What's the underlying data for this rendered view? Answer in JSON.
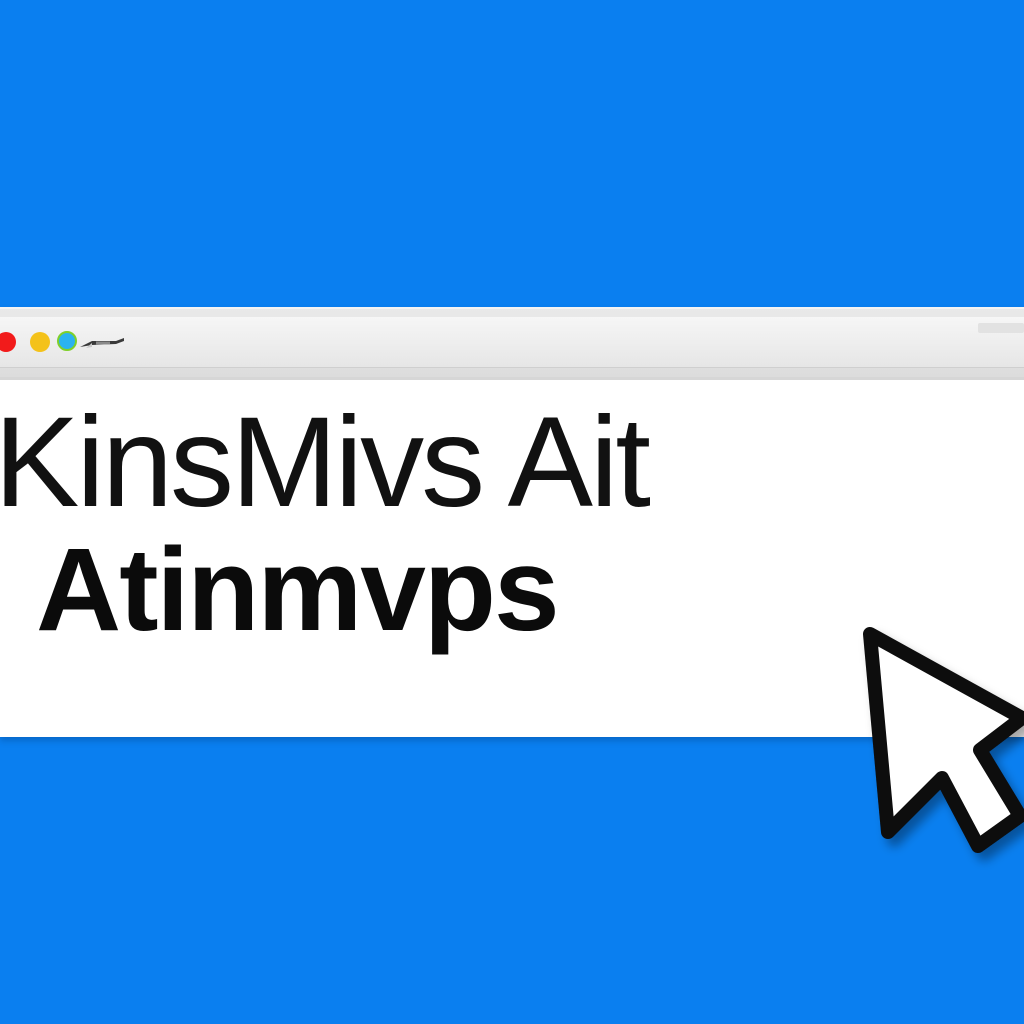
{
  "colors": {
    "background": "#0a7ff0",
    "window_close": "#f21b1b",
    "window_minimize": "#f4c21a",
    "window_zoom": "#2bb3f0",
    "text": "#111111"
  },
  "window": {
    "controls": [
      "close-icon",
      "minimize-icon",
      "zoom-icon"
    ],
    "toolbar_icon": "tool-icon"
  },
  "content": {
    "line1": "KinsMivs Ait",
    "line2": "Atinmvps"
  },
  "cursor": {
    "icon": "arrow-cursor-icon"
  }
}
